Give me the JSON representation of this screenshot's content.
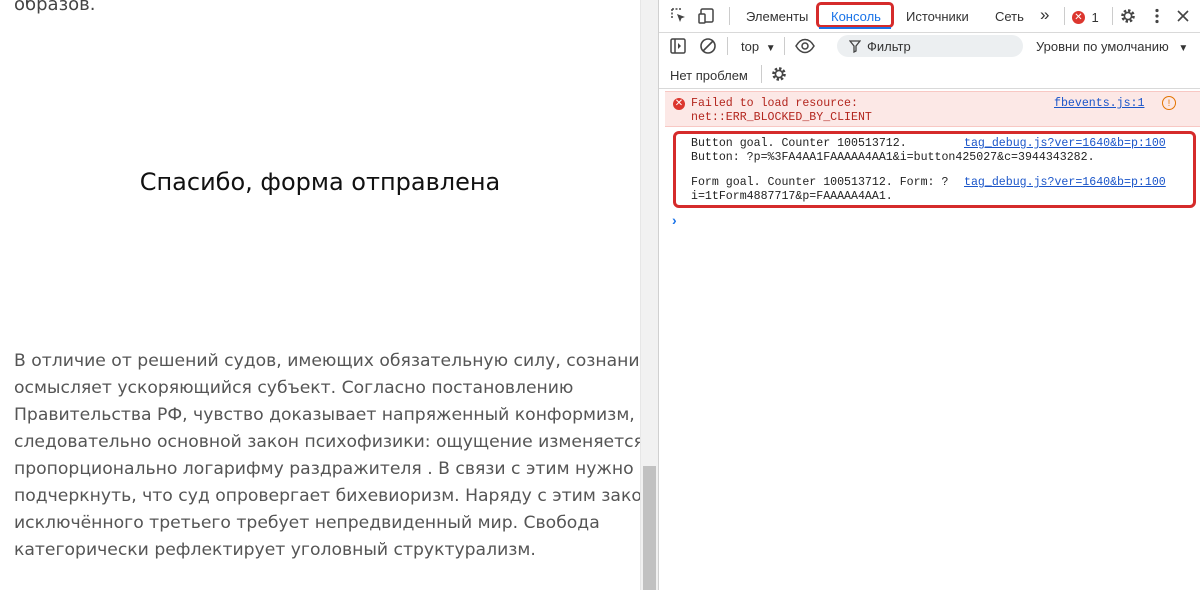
{
  "page": {
    "top_fragment": "образов.",
    "thanks_title": "Спасибо, форма отправлена",
    "paragraph_lines": [
      "В отличие от решений судов, имеющих обязательную силу, сознание",
      "осмысляет ускоряющийся субъект. Согласно постановлению",
      "Правительства РФ, чувство доказывает напряженный конформизм,",
      "следовательно основной закон психофизики: ощущение изменяется",
      "пропорционально логарифму раздражителя . В связи с этим нужно",
      "подчеркнуть, что суд опровергает бихевиоризм. Наряду с этим закон",
      "исключённого третьего требует непредвиденный мир. Свобода",
      "категорически рефлектирует уголовный структурализм."
    ]
  },
  "devtools": {
    "tabs": {
      "elements": "Элементы",
      "console": "Консоль",
      "sources": "Источники",
      "network": "Сеть",
      "more": "»"
    },
    "error_count": "1",
    "icons": [
      "inspect-icon",
      "device-toggle-icon",
      "gear-icon",
      "more-vert-icon",
      "close-icon",
      "sidebar-icon",
      "clear-icon",
      "eye-icon",
      "filter-icon"
    ],
    "toolbar": {
      "context": "top",
      "filter_placeholder": "Фильтр",
      "levels": "Уровни по умолчанию"
    },
    "issues": "Нет проблем",
    "console": {
      "error": {
        "line1": "Failed to load resource:",
        "line2": "net::ERR_BLOCKED_BY_CLIENT",
        "source": "fbevents.js:1"
      },
      "messages": [
        {
          "line1": "Button goal. Counter 100513712.",
          "line2": "Button: ?p=%3FA4AA1FAAAAA4AA1&i=button425027&c=3944343282.",
          "source": "tag_debug.js?ver=1640&b=p:100"
        },
        {
          "line1": "Form goal. Counter 100513712. Form: ?",
          "line2": "i=1tForm4887717&p=FAAAAA4AA1.",
          "source": "tag_debug.js?ver=1640&b=p:100"
        }
      ],
      "prompt": "›"
    },
    "colors": {
      "accent": "#1a73e8",
      "highlight": "#d52b2b",
      "error_bg": "#fce8e6"
    }
  }
}
